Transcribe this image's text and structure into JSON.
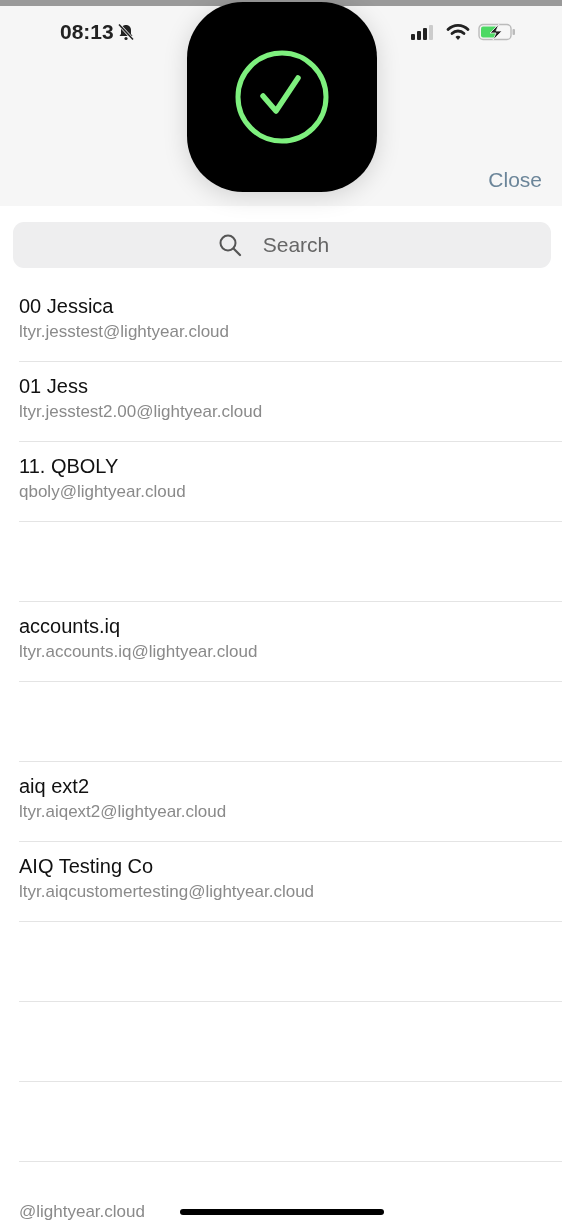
{
  "status_bar": {
    "time": "08:13",
    "silent": true,
    "charging": true
  },
  "header": {
    "close": "Close"
  },
  "hud": {
    "kind": "success"
  },
  "search": {
    "placeholder": "Search"
  },
  "contacts": [
    {
      "kind": "contact",
      "name": "00 Jessica",
      "email": "ltyr.jesstest@lightyear.cloud"
    },
    {
      "kind": "contact",
      "name": "01 Jess",
      "email": "ltyr.jesstest2.00@lightyear.cloud"
    },
    {
      "kind": "contact",
      "name": "11. QBOLY",
      "email": "qboly@lightyear.cloud"
    },
    {
      "kind": "blank"
    },
    {
      "kind": "contact",
      "name": "accounts.iq",
      "email": "ltyr.accounts.iq@lightyear.cloud"
    },
    {
      "kind": "blank"
    },
    {
      "kind": "contact",
      "name": "aiq ext2",
      "email": "ltyr.aiqext2@lightyear.cloud"
    },
    {
      "kind": "contact",
      "name": "AIQ Testing Co",
      "email": "ltyr.aiqcustomertesting@lightyear.cloud"
    },
    {
      "kind": "blank"
    },
    {
      "kind": "blank"
    },
    {
      "kind": "blank"
    },
    {
      "kind": "partial",
      "email": "@lightyear.cloud"
    }
  ]
}
